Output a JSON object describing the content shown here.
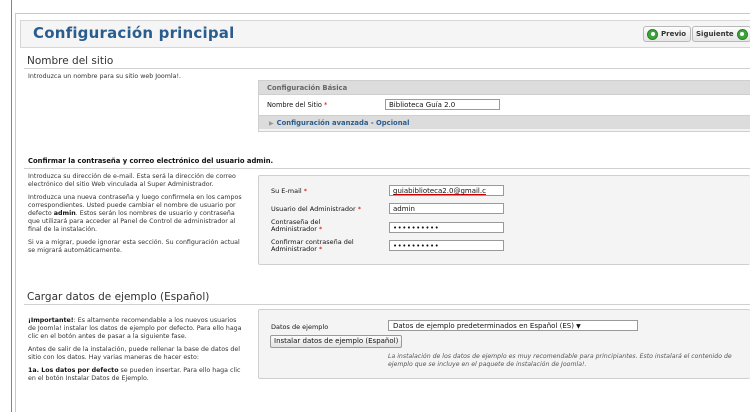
{
  "header": {
    "title": "Configuración principal",
    "prev_label": "Previo",
    "next_label": "Siguiente"
  },
  "site": {
    "heading": "Nombre del sitio",
    "intro": "Introduzca un nombre para su sitio web Joomla!.",
    "box_title": "Configuración Básica",
    "site_name_label": "Nombre del Sitio",
    "site_name_value": "Biblioteca Guía 2.0",
    "advanced_label": "Configuración avanzada - Opcional"
  },
  "admin": {
    "heading": "Confirmar la contraseña y correo electrónico del usuario admin.",
    "desc1": "Introduzca su dirección de e-mail. Esta será la dirección de correo electrónico del sitio Web vinculada al Super Administrador.",
    "desc2_pre": "Introduzca una nueva contraseña y luego confirmela en los campos correspondientes. Usted puede cambiar el nombre de usuario por defecto ",
    "desc2_bold": "admin",
    "desc2_post": ". Estos serán los nombres de usuario y contraseña que utilizará para acceder al Panel de Control de administrador al final de la instalación.",
    "desc3": "Si va a migrar, puede ignorar esta sección. Su configuración actual se migrará automáticamente.",
    "email_label": "Su E-mail",
    "email_value": "guiabiblioteca2.0@gmail.c",
    "user_label": "Usuario del Administrador",
    "user_value": "admin",
    "pass_label_1": "Contraseña del",
    "pass_label_2": "Administrador",
    "pass_value": "••••••••••",
    "confirm_label_1": "Confirmar contraseña del",
    "confirm_label_2": "Administrador",
    "confirm_value": "••••••••••",
    "required_mark": "*"
  },
  "sample": {
    "heading": "Cargar datos de ejemplo (Español)",
    "imp_bold": "¡Importante!",
    "imp_text": ": Es altamente recomendable a los nuevos usuarios de Joomla! instalar los datos de ejemplo por defecto. Para ello haga clic en el botón antes de pasar a la siguiente fase.",
    "desc2": "Antes de salir de la instalación, puede rellenar la base de datos del sitio con los datos. Hay varias maneras de hacer esto:",
    "desc3_bold": "1a. Los datos por defecto",
    "desc3_text": " se pueden insertar. Para ello haga clic en el botón Instalar Datos de Ejemplo.",
    "data_label": "Datos de ejemplo",
    "select_value": "Datos de ejemplo predeterminados en Español (ES)",
    "install_button": "Instalar datos de ejemplo (Español)",
    "note": "La instalación de los datos de ejemplo es muy recomendable para principiantes. Esto instalará el contenido de ejemplo que se incluye en el paquete de instalación de Joomla!."
  },
  "colors": {
    "title": "#2a5d8e",
    "nav_icon": "#3aa63a"
  }
}
